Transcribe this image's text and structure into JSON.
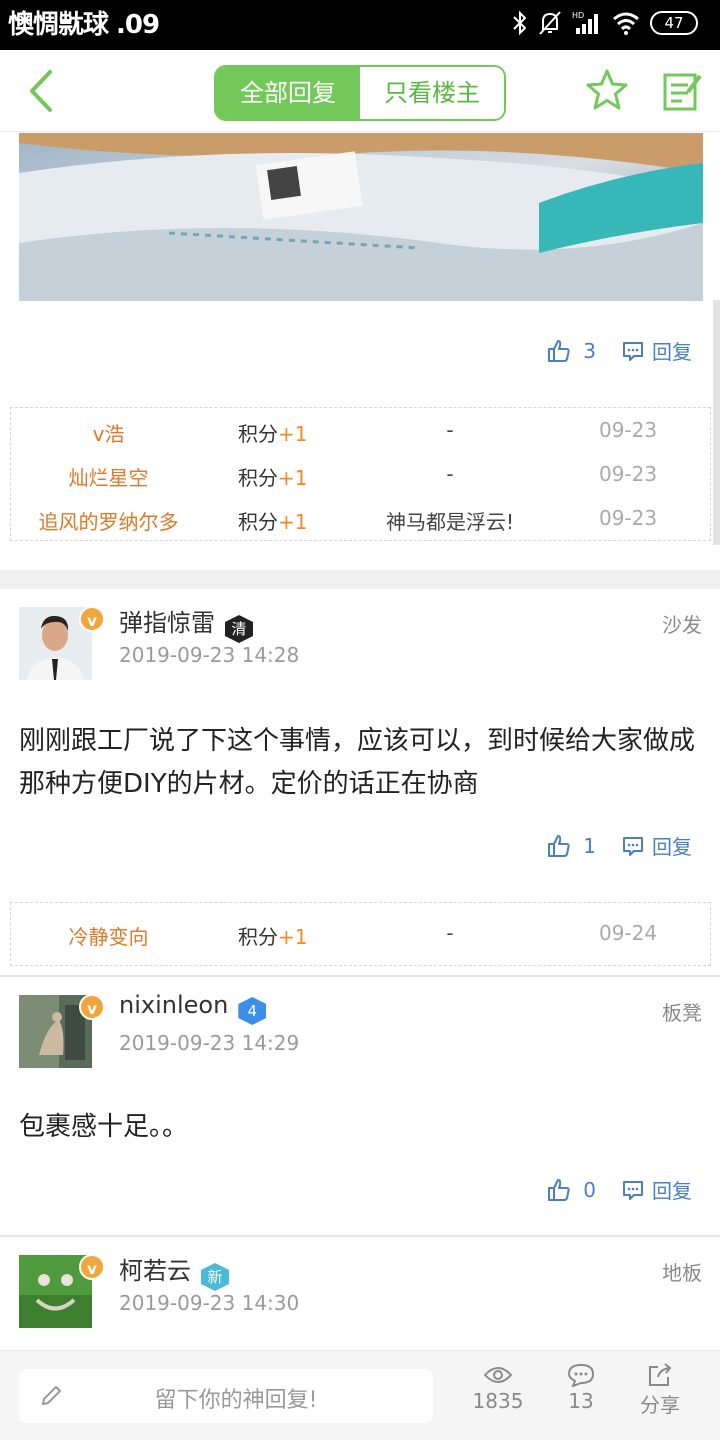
{
  "status_bar": {
    "time": "懊惆㞊球 .09",
    "battery": "47"
  },
  "header": {
    "tab_all": "全部回复",
    "tab_owner": "只看楼主"
  },
  "first_post": {
    "likes": "3",
    "reply_label": "回复"
  },
  "score_table_1": [
    {
      "user": "v浩",
      "points_label": "积分",
      "points_value": "+1",
      "message": "-",
      "date": "09-23"
    },
    {
      "user": "灿烂星空",
      "points_label": "积分",
      "points_value": "+1",
      "message": "-",
      "date": "09-23"
    },
    {
      "user": "追风的罗纳尔多",
      "points_label": "积分",
      "points_value": "+1",
      "message": "神马都是浮云!",
      "date": "09-23"
    }
  ],
  "posts": [
    {
      "username": "弹指惊雷",
      "badge": "清",
      "badge_color": "#222222",
      "time": "2019-09-23 14:28",
      "floor": "沙发",
      "content": "刚刚跟工厂说了下这个事情，应该可以，到时候给大家做成那种方便DIY的片材。定价的话正在协商",
      "likes": "1",
      "reply_label": "回复"
    },
    {
      "username": "nixinleon",
      "badge": "4",
      "badge_color": "#3d8ee8",
      "time": "2019-09-23 14:29",
      "floor": "板凳",
      "content": "包裹感十足。。",
      "likes": "0",
      "reply_label": "回复"
    },
    {
      "username": "柯若云",
      "badge": "新",
      "badge_color": "#4bbad6",
      "time": "2019-09-23 14:30",
      "floor": "地板"
    }
  ],
  "score_table_2": [
    {
      "user": "冷静变向",
      "points_label": "积分",
      "points_value": "+1",
      "message": "-",
      "date": "09-24"
    }
  ],
  "bottom_bar": {
    "placeholder": "留下你的神回复!",
    "views": "1835",
    "comments": "13",
    "share": "分享"
  },
  "colors": {
    "accent_green": "#73c85a",
    "link_blue": "#4a7fc1",
    "user_orange": "#e0782a",
    "points_orange": "#f08a24"
  }
}
